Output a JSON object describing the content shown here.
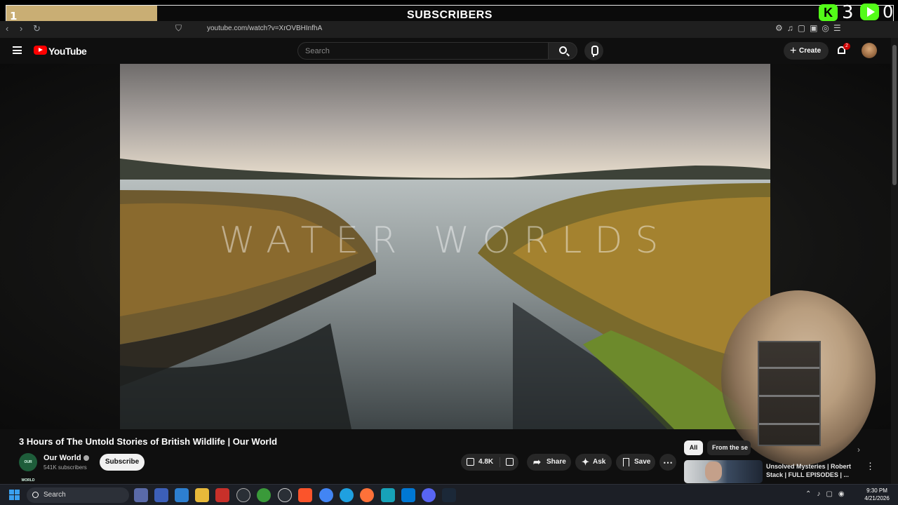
{
  "overlay": {
    "goal_count": "1",
    "goal_label": "SUBSCRIBERS",
    "goal_progress": 0.17,
    "kick_logo": "K",
    "kick_count": "3",
    "play_count": "0"
  },
  "browser": {
    "url": "youtube.com/watch?v=XrOVBHInfhA"
  },
  "header": {
    "logo_text": "YouTube",
    "search_placeholder": "Search",
    "create_label": "Create",
    "notification_count": "2"
  },
  "video": {
    "overlay_text": "WATER WORLDS",
    "title": "3 Hours of The Untold Stories of British Wildlife | Our World"
  },
  "channel": {
    "avatar_text": "OUR WORLD",
    "name": "Our World",
    "subscribers": "541K subscribers",
    "subscribe_label": "Subscribe"
  },
  "actions": {
    "likes": "4.8K",
    "share": "Share",
    "ask": "Ask",
    "save": "Save"
  },
  "sidebar": {
    "chips": [
      "All",
      "From the se"
    ],
    "rec_title": "Unsolved Mysteries | Robert Stack | FULL EPISODES | ..."
  },
  "taskbar": {
    "search_label": "Search",
    "time": "9:30 PM",
    "date": "4/21/2026"
  },
  "colors": {
    "yt_red": "#ff0000",
    "kick_green": "#53fc18",
    "goal_fill": "#c9ae74",
    "background": "#0f0f0f"
  }
}
